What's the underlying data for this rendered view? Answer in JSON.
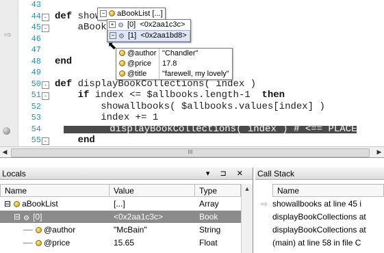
{
  "editor": {
    "lines": [
      {
        "num": "43",
        "text": "",
        "fold": ""
      },
      {
        "num": "44",
        "pre": "",
        "kw": "def",
        "text": " showBookList )",
        "fold": "-"
      },
      {
        "num": "45",
        "pre": "    ",
        "kw": "",
        "text": "aBookList.book|",
        "fold": "-"
      },
      {
        "num": "46",
        "pre": "    ",
        "kw": "",
        "text": "",
        "fold": ""
      },
      {
        "num": "47",
        "pre": "",
        "kw": "",
        "text": "",
        "fold": ""
      },
      {
        "num": "48",
        "pre": "",
        "kw": "end",
        "text": "",
        "fold": ""
      },
      {
        "num": "49",
        "pre": "",
        "kw": "",
        "text": "",
        "fold": ""
      },
      {
        "num": "50",
        "pre": "",
        "kw": "def",
        "text": " displayBookCollections( index )",
        "fold": "-"
      },
      {
        "num": "51",
        "pre": "    ",
        "kw": "if",
        "text": " index <= $allbooks.length-1  ",
        "kw2": "then",
        "fold": "-"
      },
      {
        "num": "52",
        "pre": "        ",
        "kw": "",
        "text": "showallbooks( $allbooks.values[index] )",
        "fold": ""
      },
      {
        "num": "53",
        "pre": "        ",
        "kw": "",
        "text": "index += 1",
        "fold": ""
      },
      {
        "num": "54",
        "pre": "        ",
        "kw": "",
        "text": "displayBookCollections( index ) # <== PLACE",
        "fold": "",
        "highlight": true
      },
      {
        "num": "55",
        "pre": "    ",
        "kw": "end",
        "text": "",
        "fold": "-"
      }
    ],
    "hscroll_label": "III"
  },
  "tooltip": {
    "root": {
      "name": "aBookList",
      "value": "[...]"
    },
    "items": [
      {
        "name": "[0]",
        "value": "<0x2aa1c3c>"
      },
      {
        "name": "[1]",
        "value": "<0x2aa1bd8>"
      }
    ],
    "details": [
      {
        "key": "@author",
        "value": "\"Chandler\""
      },
      {
        "key": "@price",
        "value": "17.8"
      },
      {
        "key": "@title",
        "value": "\"farewell, my lovely\""
      }
    ]
  },
  "locals": {
    "title": "Locals",
    "buttons": "▾ ⊐ ✕",
    "headers": {
      "name": "Name",
      "value": "Value",
      "type": "Type"
    },
    "rows": [
      {
        "expander": "⊟",
        "name": "aBookList",
        "value": "[...]",
        "type": "Array",
        "indent": 0
      },
      {
        "expander": "⊟",
        "name": "[0]",
        "value": "<0x2aa1c3c>",
        "type": "Book",
        "indent": 1,
        "selected": true
      },
      {
        "expander": "",
        "name": "@author",
        "value": "\"McBain\"",
        "type": "String",
        "indent": 2
      },
      {
        "expander": "",
        "name": "@price",
        "value": "15.65",
        "type": "Float",
        "indent": 2
      }
    ]
  },
  "callstack": {
    "title": "Call Stack",
    "header": "Name",
    "rows": [
      {
        "text": "showallbooks at line 45 i",
        "current": true
      },
      {
        "text": "displayBookCollections at",
        "current": false
      },
      {
        "text": "displayBookCollections at",
        "current": false
      },
      {
        "text": "(main) at line 58 in file C",
        "current": false
      }
    ]
  },
  "colors": {
    "highlight": "#4a4a4a",
    "selected_row": "#8b8b8b",
    "line_numbers": "#2b91af"
  }
}
